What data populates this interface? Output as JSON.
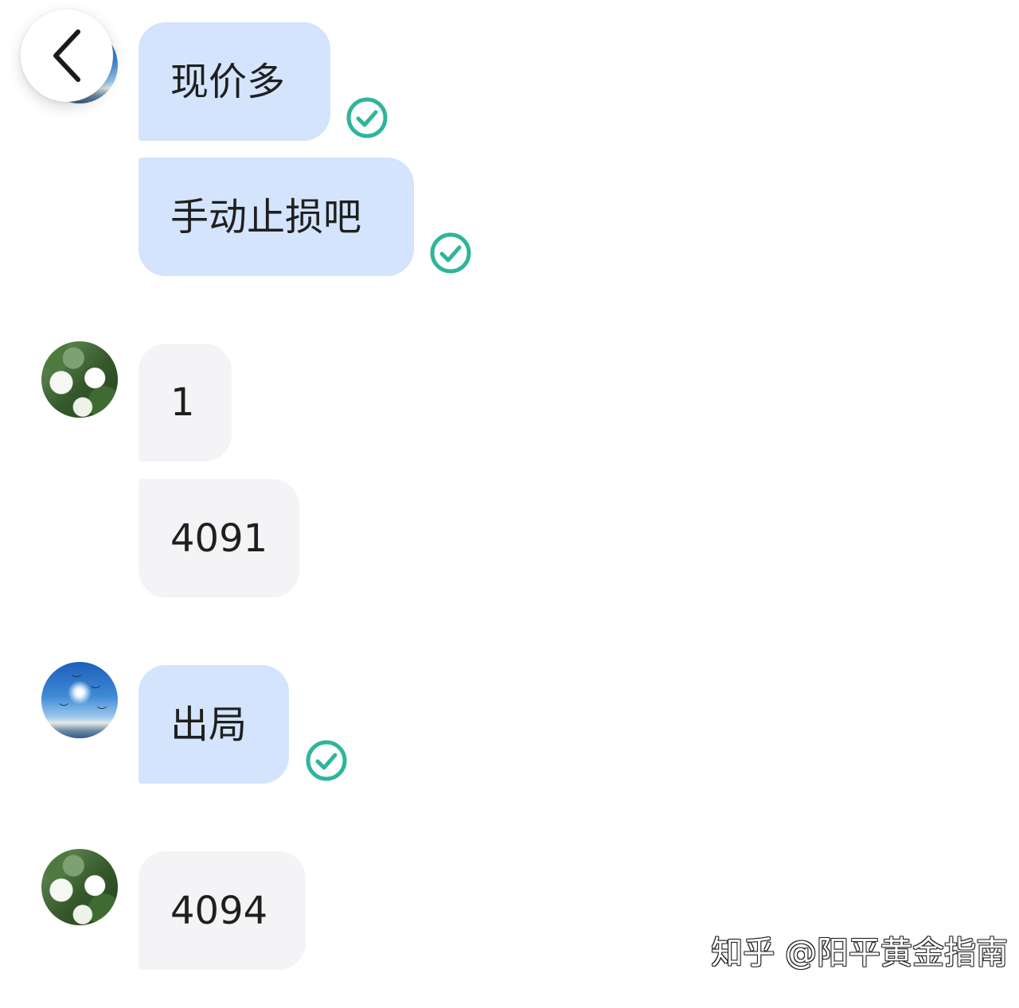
{
  "header": {
    "back_icon": "chevron-left-icon"
  },
  "messages": [
    {
      "sender": "self",
      "text": "现价多",
      "status_icon": "read-check-icon"
    },
    {
      "sender": "self",
      "text": "手动止损吧",
      "status_icon": "read-check-icon"
    },
    {
      "sender": "other",
      "text": "1"
    },
    {
      "sender": "other",
      "text": "4091"
    },
    {
      "sender": "self",
      "text": "出局",
      "status_icon": "read-check-icon"
    },
    {
      "sender": "other",
      "text": "4094"
    }
  ],
  "colors": {
    "self_bubble": "#d3e4fc",
    "other_bubble": "#f4f4f6",
    "check": "#2fb59a",
    "text": "#1f1f1f"
  },
  "watermark": {
    "text": "知乎 @阳平黄金指南"
  }
}
